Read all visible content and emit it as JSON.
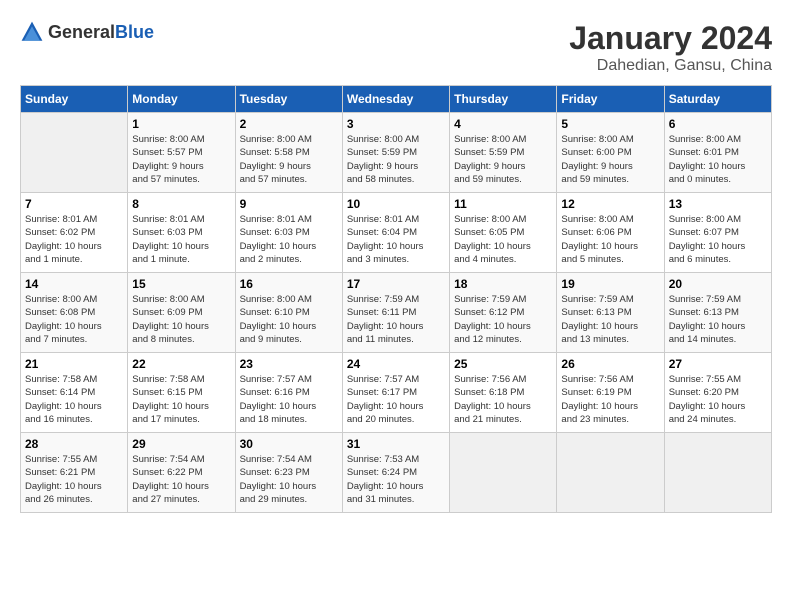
{
  "header": {
    "logo_general": "General",
    "logo_blue": "Blue",
    "month_year": "January 2024",
    "location": "Dahedian, Gansu, China"
  },
  "days_of_week": [
    "Sunday",
    "Monday",
    "Tuesday",
    "Wednesday",
    "Thursday",
    "Friday",
    "Saturday"
  ],
  "weeks": [
    [
      {
        "day": "",
        "info": ""
      },
      {
        "day": "1",
        "info": "Sunrise: 8:00 AM\nSunset: 5:57 PM\nDaylight: 9 hours\nand 57 minutes."
      },
      {
        "day": "2",
        "info": "Sunrise: 8:00 AM\nSunset: 5:58 PM\nDaylight: 9 hours\nand 57 minutes."
      },
      {
        "day": "3",
        "info": "Sunrise: 8:00 AM\nSunset: 5:59 PM\nDaylight: 9 hours\nand 58 minutes."
      },
      {
        "day": "4",
        "info": "Sunrise: 8:00 AM\nSunset: 5:59 PM\nDaylight: 9 hours\nand 59 minutes."
      },
      {
        "day": "5",
        "info": "Sunrise: 8:00 AM\nSunset: 6:00 PM\nDaylight: 9 hours\nand 59 minutes."
      },
      {
        "day": "6",
        "info": "Sunrise: 8:00 AM\nSunset: 6:01 PM\nDaylight: 10 hours\nand 0 minutes."
      }
    ],
    [
      {
        "day": "7",
        "info": "Sunrise: 8:01 AM\nSunset: 6:02 PM\nDaylight: 10 hours\nand 1 minute."
      },
      {
        "day": "8",
        "info": "Sunrise: 8:01 AM\nSunset: 6:03 PM\nDaylight: 10 hours\nand 1 minute."
      },
      {
        "day": "9",
        "info": "Sunrise: 8:01 AM\nSunset: 6:03 PM\nDaylight: 10 hours\nand 2 minutes."
      },
      {
        "day": "10",
        "info": "Sunrise: 8:01 AM\nSunset: 6:04 PM\nDaylight: 10 hours\nand 3 minutes."
      },
      {
        "day": "11",
        "info": "Sunrise: 8:00 AM\nSunset: 6:05 PM\nDaylight: 10 hours\nand 4 minutes."
      },
      {
        "day": "12",
        "info": "Sunrise: 8:00 AM\nSunset: 6:06 PM\nDaylight: 10 hours\nand 5 minutes."
      },
      {
        "day": "13",
        "info": "Sunrise: 8:00 AM\nSunset: 6:07 PM\nDaylight: 10 hours\nand 6 minutes."
      }
    ],
    [
      {
        "day": "14",
        "info": "Sunrise: 8:00 AM\nSunset: 6:08 PM\nDaylight: 10 hours\nand 7 minutes."
      },
      {
        "day": "15",
        "info": "Sunrise: 8:00 AM\nSunset: 6:09 PM\nDaylight: 10 hours\nand 8 minutes."
      },
      {
        "day": "16",
        "info": "Sunrise: 8:00 AM\nSunset: 6:10 PM\nDaylight: 10 hours\nand 9 minutes."
      },
      {
        "day": "17",
        "info": "Sunrise: 7:59 AM\nSunset: 6:11 PM\nDaylight: 10 hours\nand 11 minutes."
      },
      {
        "day": "18",
        "info": "Sunrise: 7:59 AM\nSunset: 6:12 PM\nDaylight: 10 hours\nand 12 minutes."
      },
      {
        "day": "19",
        "info": "Sunrise: 7:59 AM\nSunset: 6:13 PM\nDaylight: 10 hours\nand 13 minutes."
      },
      {
        "day": "20",
        "info": "Sunrise: 7:59 AM\nSunset: 6:13 PM\nDaylight: 10 hours\nand 14 minutes."
      }
    ],
    [
      {
        "day": "21",
        "info": "Sunrise: 7:58 AM\nSunset: 6:14 PM\nDaylight: 10 hours\nand 16 minutes."
      },
      {
        "day": "22",
        "info": "Sunrise: 7:58 AM\nSunset: 6:15 PM\nDaylight: 10 hours\nand 17 minutes."
      },
      {
        "day": "23",
        "info": "Sunrise: 7:57 AM\nSunset: 6:16 PM\nDaylight: 10 hours\nand 18 minutes."
      },
      {
        "day": "24",
        "info": "Sunrise: 7:57 AM\nSunset: 6:17 PM\nDaylight: 10 hours\nand 20 minutes."
      },
      {
        "day": "25",
        "info": "Sunrise: 7:56 AM\nSunset: 6:18 PM\nDaylight: 10 hours\nand 21 minutes."
      },
      {
        "day": "26",
        "info": "Sunrise: 7:56 AM\nSunset: 6:19 PM\nDaylight: 10 hours\nand 23 minutes."
      },
      {
        "day": "27",
        "info": "Sunrise: 7:55 AM\nSunset: 6:20 PM\nDaylight: 10 hours\nand 24 minutes."
      }
    ],
    [
      {
        "day": "28",
        "info": "Sunrise: 7:55 AM\nSunset: 6:21 PM\nDaylight: 10 hours\nand 26 minutes."
      },
      {
        "day": "29",
        "info": "Sunrise: 7:54 AM\nSunset: 6:22 PM\nDaylight: 10 hours\nand 27 minutes."
      },
      {
        "day": "30",
        "info": "Sunrise: 7:54 AM\nSunset: 6:23 PM\nDaylight: 10 hours\nand 29 minutes."
      },
      {
        "day": "31",
        "info": "Sunrise: 7:53 AM\nSunset: 6:24 PM\nDaylight: 10 hours\nand 31 minutes."
      },
      {
        "day": "",
        "info": ""
      },
      {
        "day": "",
        "info": ""
      },
      {
        "day": "",
        "info": ""
      }
    ]
  ]
}
